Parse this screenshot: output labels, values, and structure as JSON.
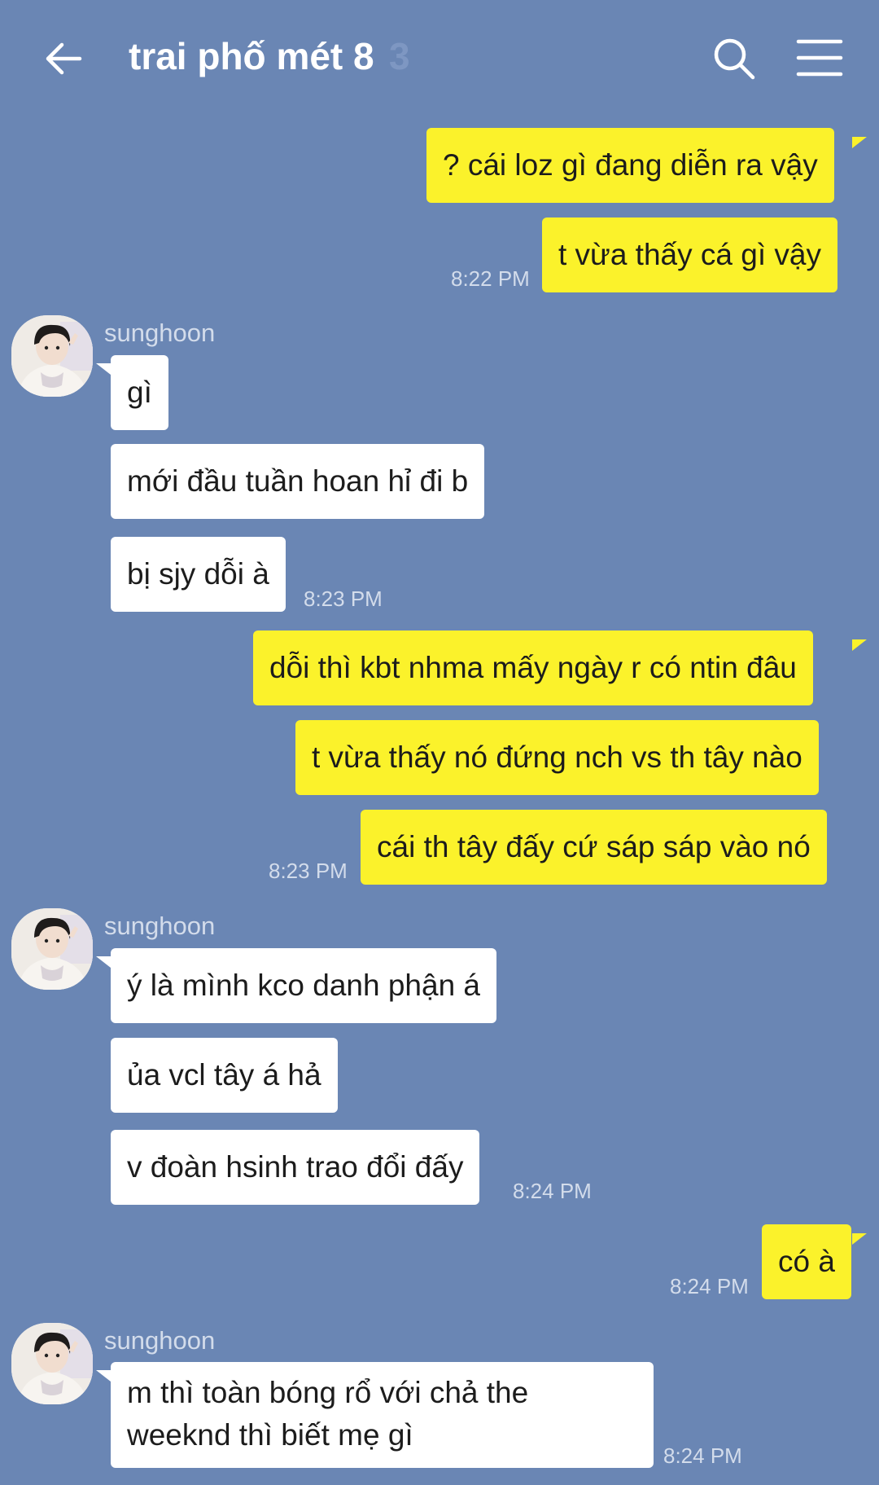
{
  "header": {
    "title": "trai phố mét 8",
    "member_count": "3",
    "back_icon": "arrow-left-icon",
    "search_icon": "search-icon",
    "menu_icon": "hamburger-menu-icon"
  },
  "colors": {
    "background": "#6a86b4",
    "my_bubble": "#fbf22b",
    "their_bubble": "#ffffff"
  },
  "messages": [
    {
      "from": "me",
      "text": "? cái loz gì đang diễn ra vậy"
    },
    {
      "from": "me",
      "text": "t vừa thấy cá gì vậy",
      "time": "8:22 PM"
    },
    {
      "from": "sunghoon",
      "sender": "sunghoon",
      "text": "gì"
    },
    {
      "from": "sunghoon",
      "text": "mới đầu tuần hoan hỉ đi b"
    },
    {
      "from": "sunghoon",
      "text": "bị sjy dỗi à",
      "time": "8:23 PM"
    },
    {
      "from": "me",
      "text": "dỗi thì kbt nhma mấy ngày r có ntin đâu"
    },
    {
      "from": "me",
      "text": "t vừa thấy nó đứng nch vs th tây nào"
    },
    {
      "from": "me",
      "text": "cái th tây đấy cứ sáp sáp vào nó",
      "time": "8:23 PM"
    },
    {
      "from": "sunghoon",
      "sender": "sunghoon",
      "text": "ý là mình kco danh phận á"
    },
    {
      "from": "sunghoon",
      "text": "ủa vcl tây á hả"
    },
    {
      "from": "sunghoon",
      "text": "v đoàn hsinh trao đổi đấy",
      "time": "8:24 PM"
    },
    {
      "from": "me",
      "text": "có à",
      "time": "8:24 PM"
    },
    {
      "from": "sunghoon",
      "sender": "sunghoon",
      "text": "m thì toàn bóng rổ với chả the weeknd thì biết mẹ gì",
      "time": "8:24 PM"
    }
  ]
}
